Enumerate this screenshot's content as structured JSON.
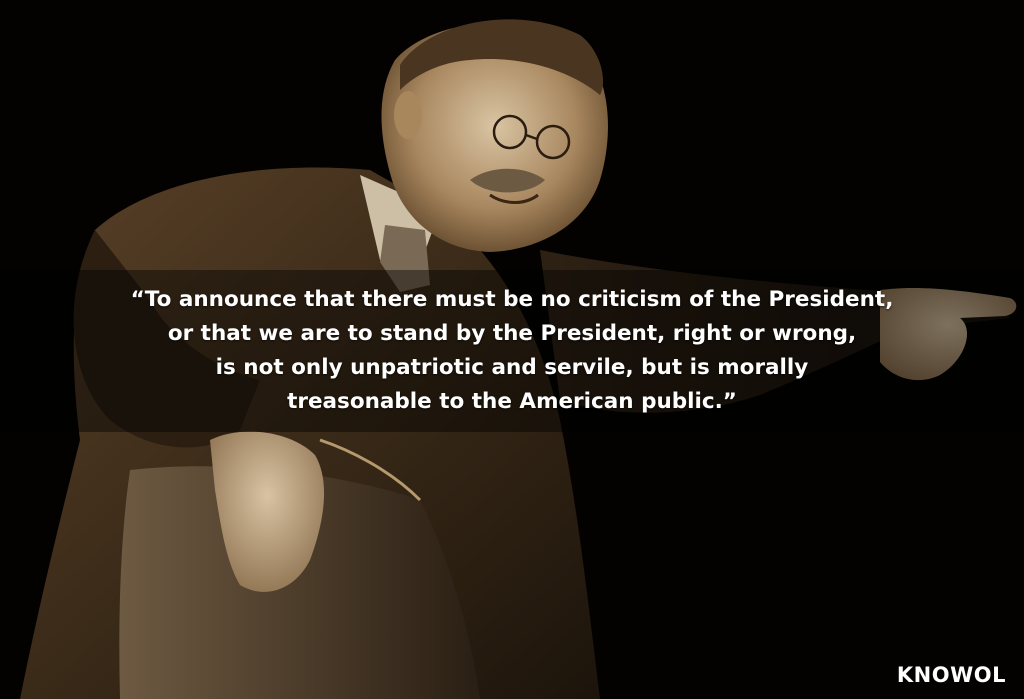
{
  "quote": {
    "lines": [
      "“To announce that there must be no criticism of the President,",
      "or that we are to stand by the President, right or wrong,",
      "is not only unpatriotic and servile, but is morally",
      "treasonable to the American public.”"
    ]
  },
  "brand": {
    "label": "KNOWOL"
  },
  "colors": {
    "background": "#030201",
    "sepia_mid": "#6b5335",
    "sepia_light": "#c9b596",
    "text": "#ffffff"
  }
}
